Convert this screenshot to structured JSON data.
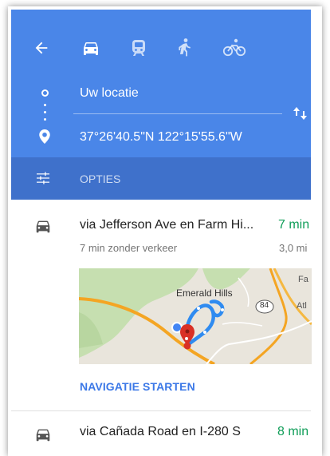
{
  "header": {
    "back_icon": "arrow-left-icon",
    "modes": [
      {
        "name": "car-icon",
        "selected": true
      },
      {
        "name": "transit-icon",
        "selected": false
      },
      {
        "name": "walk-icon",
        "selected": false
      },
      {
        "name": "bike-icon",
        "selected": false
      }
    ],
    "origin": "Uw locatie",
    "destination": "37°26'40.5\"N 122°15'55.6\"W",
    "swap_icon": "swap-vertical-icon"
  },
  "options": {
    "label": "OPTIES",
    "icon": "tune-sliders-icon"
  },
  "routes": [
    {
      "title": "via Jefferson Ave en Farm Hi...",
      "time": "7 min",
      "subtitle": "7 min zonder verkeer",
      "distance": "3,0 mi",
      "map_labels": {
        "place": "Emerald Hills",
        "route_shield": "84",
        "edge_a": "Fa",
        "edge_b": "Atl"
      },
      "action": "NAVIGATIE STARTEN"
    },
    {
      "title": "via Cañada Road en I-280 S",
      "time": "8 min"
    }
  ],
  "colors": {
    "header_blue": "#4a86e8",
    "options_blue": "#3f71cb",
    "time_green": "#0f9d58",
    "link_blue": "#3b78e7"
  }
}
